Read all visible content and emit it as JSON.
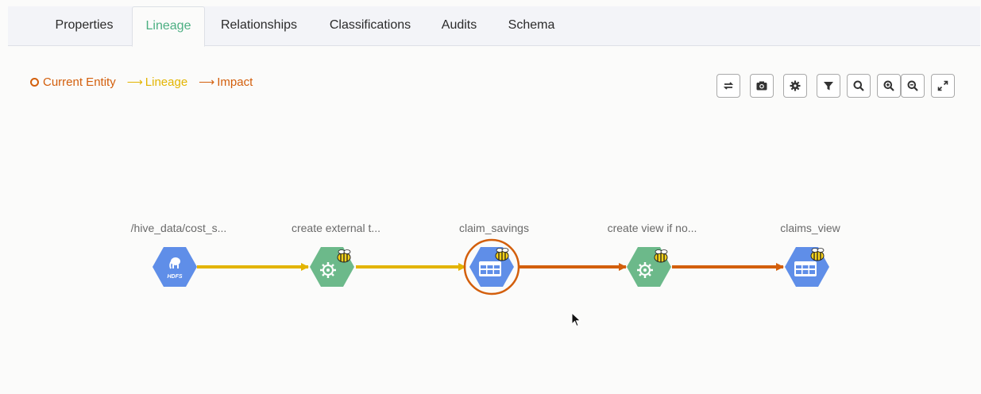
{
  "tabs": [
    {
      "label": "Properties",
      "active": false
    },
    {
      "label": "Lineage",
      "active": true
    },
    {
      "label": "Relationships",
      "active": false
    },
    {
      "label": "Classifications",
      "active": false
    },
    {
      "label": "Audits",
      "active": false
    },
    {
      "label": "Schema",
      "active": false
    }
  ],
  "legend": {
    "current_entity": "Current Entity",
    "lineage": "Lineage",
    "impact": "Impact"
  },
  "colors": {
    "current_entity": "#d35f0c",
    "lineage": "#e3b400",
    "impact": "#d35f0c",
    "active_tab": "#4caf82",
    "dataset_node": "#5f8ee8",
    "process_node": "#6cb98a"
  },
  "toolbar": [
    {
      "name": "reset-layout-icon"
    },
    {
      "name": "camera-icon"
    },
    {
      "name": "settings-icon"
    },
    {
      "name": "filter-icon"
    },
    {
      "name": "search-icon"
    },
    {
      "name": "zoom-in-icon"
    },
    {
      "name": "zoom-out-icon"
    },
    {
      "name": "fullscreen-icon"
    }
  ],
  "lineage": {
    "nodes": [
      {
        "label": "/hive_data/cost_s...",
        "kind": "hdfs",
        "icon_text": "HDFS",
        "current": false
      },
      {
        "label": "create external t...",
        "kind": "process",
        "current": false
      },
      {
        "label": "claim_savings",
        "kind": "table",
        "current": true
      },
      {
        "label": "create view if no...",
        "kind": "process",
        "current": false
      },
      {
        "label": "claims_view",
        "kind": "table",
        "current": false
      }
    ],
    "edges": [
      {
        "from": 0,
        "to": 1,
        "type": "lineage"
      },
      {
        "from": 1,
        "to": 2,
        "type": "lineage"
      },
      {
        "from": 2,
        "to": 3,
        "type": "impact"
      },
      {
        "from": 3,
        "to": 4,
        "type": "impact"
      }
    ]
  }
}
